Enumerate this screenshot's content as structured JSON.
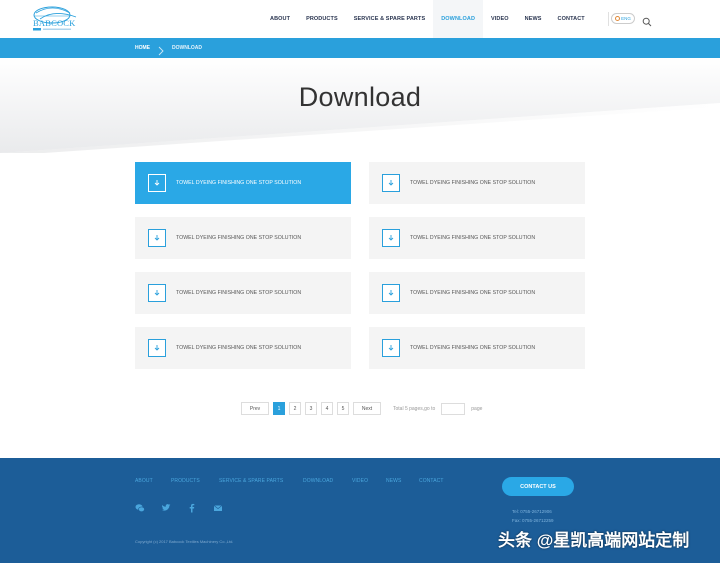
{
  "logo": {
    "text": "BABCOCK"
  },
  "nav": {
    "items": [
      {
        "label": "ABOUT"
      },
      {
        "label": "PRODUCTS"
      },
      {
        "label": "SERVICE & SPARE PARTS"
      },
      {
        "label": "DOWNLOAD"
      },
      {
        "label": "VIDEO"
      },
      {
        "label": "NEWS"
      },
      {
        "label": "CONTACT"
      }
    ],
    "active": "DOWNLOAD",
    "lang": "ENG"
  },
  "breadcrumb": {
    "home": "HOME",
    "current": "DOWNLOAD"
  },
  "page_title": "Download",
  "downloads": [
    {
      "label": "TOWEL DYEING FINISHING ONE STOP SOLUTION"
    },
    {
      "label": "TOWEL DYEING FINISHING ONE STOP SOLUTION"
    },
    {
      "label": "TOWEL DYEING FINISHING ONE STOP SOLUTION"
    },
    {
      "label": "TOWEL DYEING FINISHING ONE STOP SOLUTION"
    },
    {
      "label": "TOWEL DYEING FINISHING ONE STOP SOLUTION"
    },
    {
      "label": "TOWEL DYEING FINISHING ONE STOP SOLUTION"
    },
    {
      "label": "TOWEL DYEING FINISHING ONE STOP SOLUTION"
    },
    {
      "label": "TOWEL DYEING FINISHING ONE STOP SOLUTION"
    }
  ],
  "pagination": {
    "prev": "Prev",
    "next": "Next",
    "pages": [
      "1",
      "2",
      "3",
      "4",
      "5"
    ],
    "current": "1",
    "summary": "Total 5 pages,go to",
    "page_suffix": "page"
  },
  "footer": {
    "nav": [
      "ABOUT",
      "PRODUCTS",
      "SERVICE & SPARE PARTS",
      "DOWNLOAD",
      "VIDEO",
      "NEWS",
      "CONTACT"
    ],
    "contact_button": "CONTACT US",
    "tel": "Tel: 0755-26712906",
    "fax": "Fax: 0755-26712259",
    "copyright": "Copyright (c) 2017 Babcock Textiles Machinery Co.,Ltd."
  },
  "watermark": "头条 @星凯高端网站定制",
  "colors": {
    "accent": "#2aa0dc",
    "footer_bg": "#1c5d98",
    "card_bg": "#f4f4f4"
  }
}
